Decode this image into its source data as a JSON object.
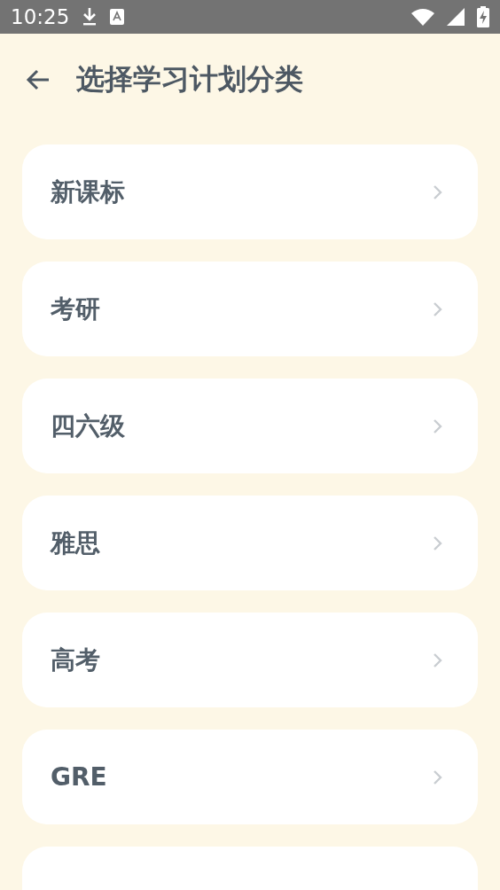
{
  "status_bar": {
    "time": "10:25"
  },
  "header": {
    "title": "选择学习计划分类"
  },
  "categories": [
    {
      "label": "新课标"
    },
    {
      "label": "考研"
    },
    {
      "label": "四六级"
    },
    {
      "label": "雅思"
    },
    {
      "label": "高考"
    },
    {
      "label": "GRE"
    }
  ]
}
